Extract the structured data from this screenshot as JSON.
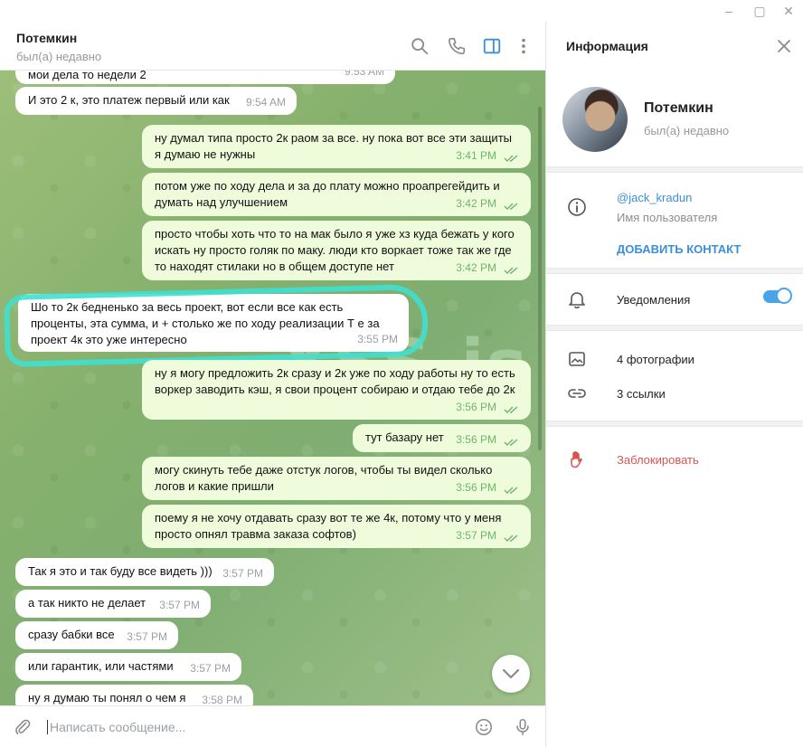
{
  "chat": {
    "name": "Потемкин",
    "status": "был(а) недавно",
    "messages": [
      {
        "dir": "in",
        "text": "мои дела то недели 2",
        "time": "9:53 AM"
      },
      {
        "dir": "in",
        "text": "И это 2 к, это платеж первый или как",
        "time": "9:54 AM"
      },
      {
        "dir": "out",
        "text": "ну думал типа просто 2к раом за все. ну пока вот все эти защиты я думаю не нужны",
        "time": "3:41 PM"
      },
      {
        "dir": "out",
        "text": "потом уже по ходу дела и за до плату можно проапрегейдить и думать над улучшением",
        "time": "3:42 PM"
      },
      {
        "dir": "out",
        "text": "просто чтобы хоть что то на мак было я уже хз куда бежать у кого искать ну просто голяк по маку. люди кто воркает тоже так же где то находят стилаки но в общем доступе нет",
        "time": "3:42 PM"
      },
      {
        "dir": "in",
        "text": "Шо то 2к бедненько за весь проект, вот если все как есть проценты, эта сумма, и + столько же по ходу реализации Т е за проект 4к это уже интересно",
        "time": "3:55 PM"
      },
      {
        "dir": "out",
        "text": "ну я могу предложить 2к сразу и 2к уже по ходу работы ну то есть воркер заводить кэш, я свои процент собираю и отдаю тебе до 2к",
        "time": "3:56 PM"
      },
      {
        "dir": "out",
        "text": "тут базару нет",
        "time": "3:56 PM"
      },
      {
        "dir": "out",
        "text": "могу скинуть тебе даже отстук логов, чтобы ты видел сколько логов и какие пришли",
        "time": "3:56 PM"
      },
      {
        "dir": "out",
        "text": "поему я не хочу отдавать сразу вот те же 4к, потому что у меня просто опнял травма заказа софтов)",
        "time": "3:57 PM"
      },
      {
        "dir": "in",
        "text": "Так я это и так буду все видеть )))",
        "time": "3:57 PM"
      },
      {
        "dir": "in",
        "text": "а так никто не делает",
        "time": "3:57 PM"
      },
      {
        "dir": "in",
        "text": "сразу бабки все",
        "time": "3:57 PM"
      },
      {
        "dir": "in",
        "text": "или гарантик, или частями",
        "time": "3:57 PM"
      },
      {
        "dir": "in",
        "text": "ну я думаю ты понял о чем я",
        "time": "3:58 PM"
      }
    ],
    "watermark": "XSS.is",
    "composer_placeholder": "Написать сообщение..."
  },
  "info": {
    "title": "Информация",
    "name": "Потемкин",
    "status": "был(а) недавно",
    "username": "@jack_kradun",
    "username_label": "Имя пользователя",
    "add_contact": "ДОБАВИТЬ КОНТАКТ",
    "notifications": "Уведомления",
    "notifications_on": true,
    "photos": "4 фотографии",
    "links": "3 ссылки",
    "block": "Заблокировать"
  },
  "colors": {
    "accent": "#3a8fd9",
    "out_bubble": "#eefcdc",
    "time_out": "#6eb56b",
    "highlight": "#3fe0d0",
    "danger": "#d9534f"
  }
}
